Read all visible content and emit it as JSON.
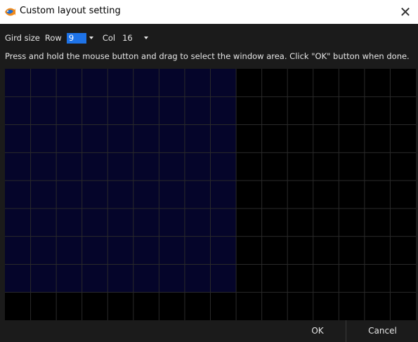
{
  "window": {
    "title": "Custom layout setting",
    "app_icon": "fish-logo-icon",
    "close_glyph": "✕"
  },
  "toolbar": {
    "grid_label": "Gird size",
    "row_label": "Row",
    "row_value": "9",
    "col_label": "Col",
    "col_value": "16"
  },
  "instruction": "Press and hold the mouse button and drag to select the window area. Click \"OK\" button when done.",
  "grid": {
    "rows": 9,
    "cols": 16,
    "selection": {
      "rows": 8,
      "cols": 9
    },
    "colors": {
      "background": "#000000",
      "lines": "#2a2a2a",
      "selection": "#05052a"
    }
  },
  "buttons": {
    "ok": "OK",
    "cancel": "Cancel"
  }
}
